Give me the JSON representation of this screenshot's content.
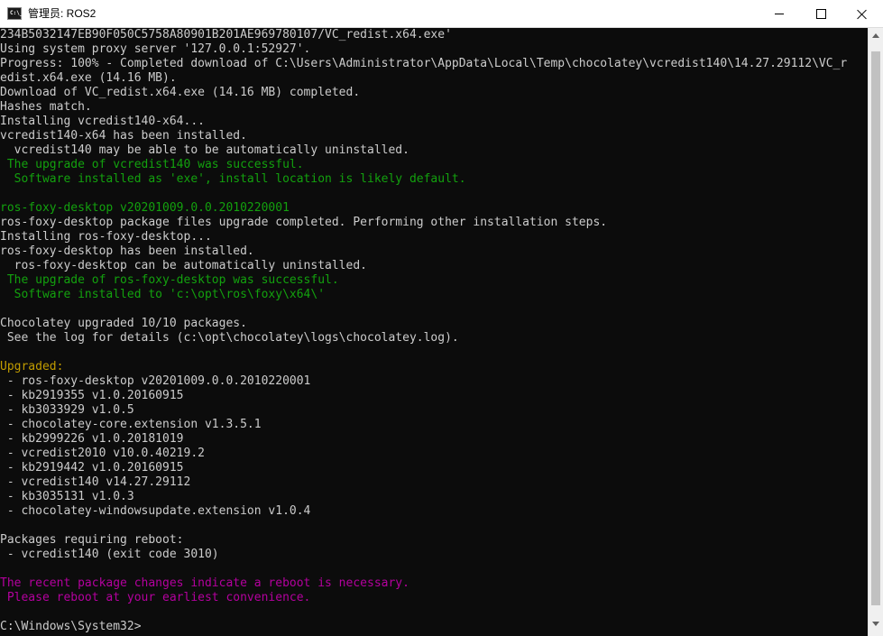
{
  "window": {
    "title": "管理员: ROS2",
    "icon": "cmd-icon",
    "icon_text": "C:\\_",
    "controls": {
      "minimize": "minimize-icon",
      "maximize": "maximize-icon",
      "close": "close-icon"
    }
  },
  "colors": {
    "background": "#0c0c0c",
    "default": "#cccccc",
    "green": "#13a10e",
    "yellow": "#c19c00",
    "magenta": "#b4009e"
  },
  "console": {
    "lines": [
      {
        "text": "234B5032147EB90F050C5758A80901B201AE969780107/VC_redist.x64.exe'",
        "color": "default"
      },
      {
        "text": "Using system proxy server '127.0.0.1:52927'.",
        "color": "default"
      },
      {
        "text": "Progress: 100% - Completed download of C:\\Users\\Administrator\\AppData\\Local\\Temp\\chocolatey\\vcredist140\\14.27.29112\\VC_r",
        "color": "default"
      },
      {
        "text": "edist.x64.exe (14.16 MB).",
        "color": "default"
      },
      {
        "text": "Download of VC_redist.x64.exe (14.16 MB) completed.",
        "color": "default"
      },
      {
        "text": "Hashes match.",
        "color": "default"
      },
      {
        "text": "Installing vcredist140-x64...",
        "color": "default"
      },
      {
        "text": "vcredist140-x64 has been installed.",
        "color": "default"
      },
      {
        "text": "  vcredist140 may be able to be automatically uninstalled.",
        "color": "default"
      },
      {
        "text": " The upgrade of vcredist140 was successful.",
        "color": "green"
      },
      {
        "text": "  Software installed as 'exe', install location is likely default.",
        "color": "green"
      },
      {
        "text": "",
        "color": "default"
      },
      {
        "text": "ros-foxy-desktop v20201009.0.0.2010220001",
        "color": "green"
      },
      {
        "text": "ros-foxy-desktop package files upgrade completed. Performing other installation steps.",
        "color": "default"
      },
      {
        "text": "Installing ros-foxy-desktop...",
        "color": "default"
      },
      {
        "text": "ros-foxy-desktop has been installed.",
        "color": "default"
      },
      {
        "text": "  ros-foxy-desktop can be automatically uninstalled.",
        "color": "default"
      },
      {
        "text": " The upgrade of ros-foxy-desktop was successful.",
        "color": "green"
      },
      {
        "text": "  Software installed to 'c:\\opt\\ros\\foxy\\x64\\'",
        "color": "green"
      },
      {
        "text": "",
        "color": "default"
      },
      {
        "text": "Chocolatey upgraded 10/10 packages.",
        "color": "default"
      },
      {
        "text": " See the log for details (c:\\opt\\chocolatey\\logs\\chocolatey.log).",
        "color": "default"
      },
      {
        "text": "",
        "color": "default"
      },
      {
        "text": "Upgraded:",
        "color": "yellow"
      },
      {
        "text": " - ros-foxy-desktop v20201009.0.0.2010220001",
        "color": "default"
      },
      {
        "text": " - kb2919355 v1.0.20160915",
        "color": "default"
      },
      {
        "text": " - kb3033929 v1.0.5",
        "color": "default"
      },
      {
        "text": " - chocolatey-core.extension v1.3.5.1",
        "color": "default"
      },
      {
        "text": " - kb2999226 v1.0.20181019",
        "color": "default"
      },
      {
        "text": " - vcredist2010 v10.0.40219.2",
        "color": "default"
      },
      {
        "text": " - kb2919442 v1.0.20160915",
        "color": "default"
      },
      {
        "text": " - vcredist140 v14.27.29112",
        "color": "default"
      },
      {
        "text": " - kb3035131 v1.0.3",
        "color": "default"
      },
      {
        "text": " - chocolatey-windowsupdate.extension v1.0.4",
        "color": "default"
      },
      {
        "text": "",
        "color": "default"
      },
      {
        "text": "Packages requiring reboot:",
        "color": "default"
      },
      {
        "text": " - vcredist140 (exit code 3010)",
        "color": "default"
      },
      {
        "text": "",
        "color": "default"
      },
      {
        "text": "The recent package changes indicate a reboot is necessary.",
        "color": "magenta"
      },
      {
        "text": " Please reboot at your earliest convenience.",
        "color": "magenta"
      },
      {
        "text": "",
        "color": "default"
      },
      {
        "text": "C:\\Windows\\System32>",
        "color": "default"
      }
    ]
  }
}
